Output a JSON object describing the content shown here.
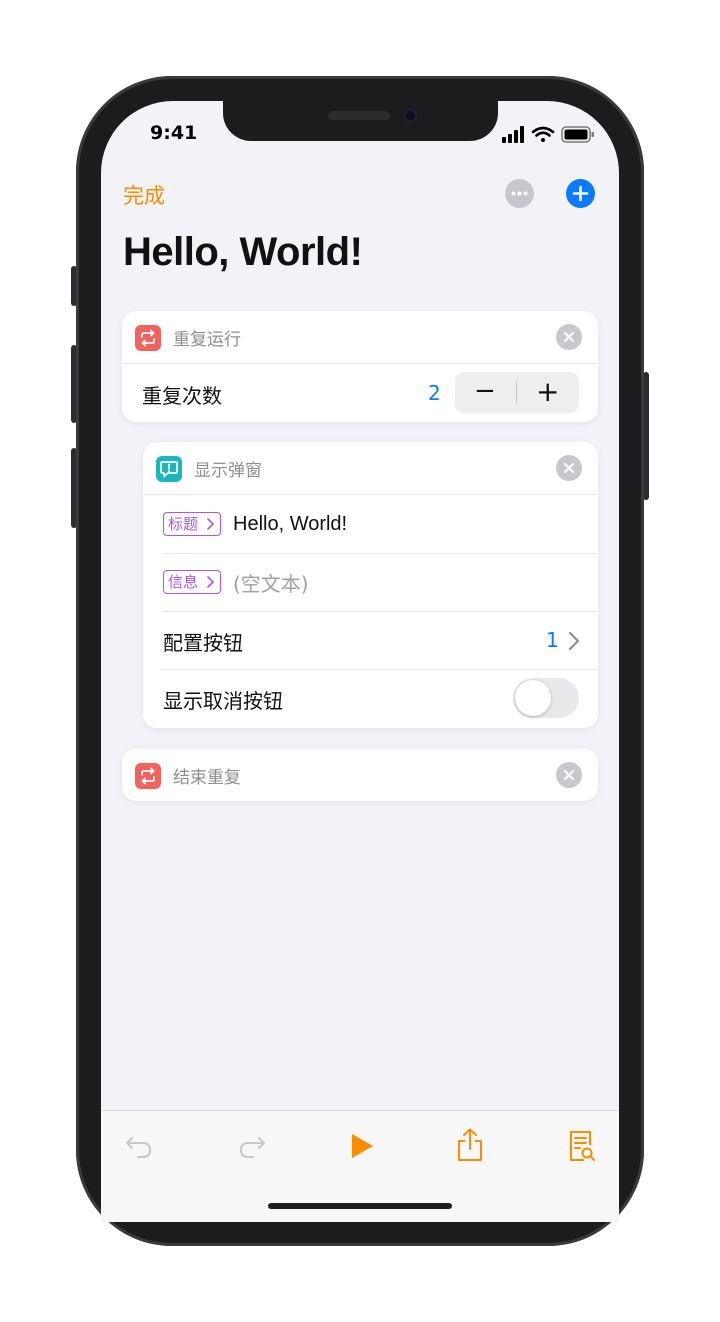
{
  "status_bar": {
    "time": "9:41"
  },
  "nav": {
    "done_label": "完成",
    "more_icon": "ellipsis-circle-icon",
    "add_icon": "plus-circle-icon"
  },
  "page": {
    "title": "Hello, World!"
  },
  "colors": {
    "accent": "#ff8c00",
    "blue": "#0a7aff",
    "token": "#a855f7",
    "repeat": "#f2625f",
    "alert": "#1fb5c0"
  },
  "actions": {
    "repeat": {
      "header": "重复运行",
      "count_label": "重复次数",
      "count_value": "2",
      "minus": "−",
      "plus": "+"
    },
    "alert": {
      "header": "显示弹窗",
      "title_token": "标题",
      "title_value": "Hello, World!",
      "message_token": "信息",
      "message_placeholder": "(空文本)",
      "buttons_label": "配置按钮",
      "buttons_value": "1",
      "cancel_label": "显示取消按钮",
      "cancel_on": false
    },
    "end_repeat": {
      "header": "结束重复"
    }
  },
  "toolbar": {
    "items": [
      "undo-icon",
      "redo-icon",
      "play-icon",
      "share-icon",
      "details-icon"
    ]
  }
}
